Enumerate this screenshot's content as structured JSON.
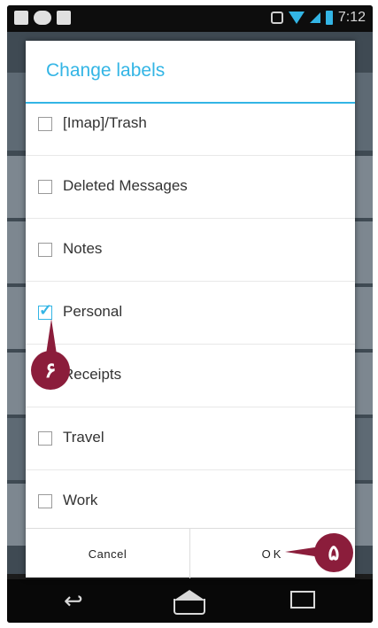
{
  "statusbar": {
    "time": "7:12"
  },
  "dialog": {
    "title": "Change labels",
    "items": [
      {
        "label": "[Imap]/Trash",
        "checked": false
      },
      {
        "label": "Deleted Messages",
        "checked": false
      },
      {
        "label": "Notes",
        "checked": false
      },
      {
        "label": "Personal",
        "checked": true
      },
      {
        "label": "Receipts",
        "checked": false
      },
      {
        "label": "Travel",
        "checked": false
      },
      {
        "label": "Work",
        "checked": false
      }
    ],
    "cancel_label": "Cancel",
    "ok_label": "OK"
  },
  "annotations": {
    "marker_6": "۶",
    "marker_5": "۵"
  },
  "colors": {
    "accent": "#33b5e5",
    "marker": "#8b1d3b"
  },
  "icons": [
    "notification-icon",
    "gamepad-icon",
    "notification-icon",
    "sync-icon",
    "wifi-icon",
    "signal-icon",
    "battery-icon",
    "back-icon",
    "home-icon",
    "recent-apps-icon"
  ]
}
